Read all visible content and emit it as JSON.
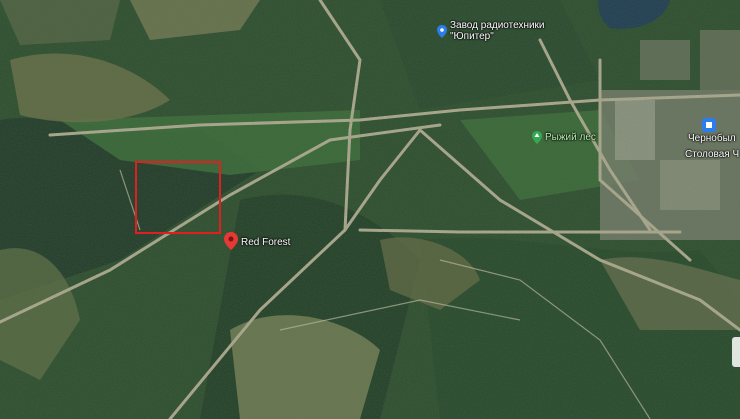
{
  "map": {
    "labels": {
      "factory": "Завод радиотехники\n\"Юпитер\"",
      "red_forest_ru": "Рыжий лес",
      "red_forest_en": "Red Forest",
      "cafe": "Столовая Ч",
      "city_fragment": "Чернобыл"
    },
    "icons": {
      "factory": "blue-pin-icon",
      "red_forest_ru": "green-tree-pin-icon",
      "red_forest_en": "red-pin-icon",
      "cafe": "blue-pin-icon",
      "highlight": "red-rectangle"
    },
    "colors": {
      "forest_dark": "#223b22",
      "forest": "#2f5230",
      "clearing": "#6b7a4e",
      "sand": "#a79f7a",
      "road": "#b9b09a",
      "water": "#1f3a55",
      "highlight": "#e02020",
      "marker_red": "#e53935",
      "marker_blue": "#2b7de9",
      "marker_green": "#35a853"
    }
  }
}
